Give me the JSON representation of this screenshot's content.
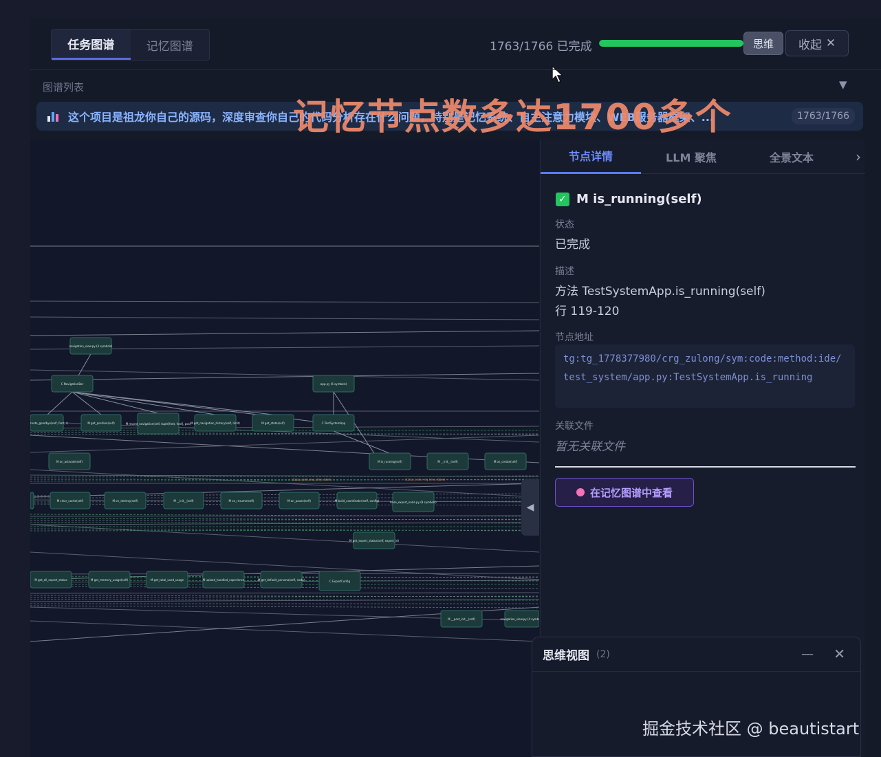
{
  "tabs": [
    {
      "label": "任务图谱",
      "active": true
    },
    {
      "label": "记忆图谱",
      "active": false
    }
  ],
  "progress": {
    "text": "1763/1766 已完成",
    "done": 1763,
    "total": 1766
  },
  "buttons": {
    "think": "思维",
    "collapse": "收起"
  },
  "graph_list": {
    "title": "图谱列表",
    "item_text": "这个项目是祖龙你自己的源码，深度审查你自己的代码分析存在什么问题，特别是记忆系统、自主注意力模块、WEB服务器框架、...",
    "item_count": "1763/1766"
  },
  "overlay_caption": "记忆节点数多达1700多个",
  "graph_nodes": [
    {
      "label": "navigation_view.py (4 symbols)"
    },
    {
      "label": "C NavigationBar"
    },
    {
      "label": "app.py (6 symbols)"
    },
    {
      "label": "M create_goodbye(self, font, r)"
    },
    {
      "label": "M get_position(self)"
    },
    {
      "label": "M record_navigation(self, tuple[font, font], pos)"
    },
    {
      "label": "M get_navigation_history(self, limit)"
    },
    {
      "label": "M get_state(self)"
    },
    {
      "label": "C TestSystemApp"
    },
    {
      "label": "M on_activate(self)"
    },
    {
      "label": "M is_running(self)"
    },
    {
      "label": "M __init__(self)"
    },
    {
      "label": "M on_create(self)"
    },
    {
      "label": "M get_state(self)"
    },
    {
      "label": "M clear_cache(self)"
    },
    {
      "label": "M on_destroy(self)"
    },
    {
      "label": "M __init__(self)"
    },
    {
      "label": "M on_resume(self)"
    },
    {
      "label": "M on_pause(self)"
    },
    {
      "label": "M build_coordinator(self, config)"
    },
    {
      "label": "base_expert_node.py (8 symbols)"
    },
    {
      "label": "M get_expert_status(self, expert_id)"
    },
    {
      "label": "M get_all_expert_status"
    },
    {
      "label": "M get_memory_usage(self)"
    },
    {
      "label": "M get_total_used_usage"
    },
    {
      "label": "M upload_handled_experience"
    },
    {
      "label": "M get_default_persona(self, node)"
    },
    {
      "label": "C ExpertConfig"
    },
    {
      "label": "M __post_init__(self)"
    }
  ],
  "graph_edge_labels": [
    "status_code, req_time, labels",
    "status_code, req_time, labels"
  ],
  "panel": {
    "tabs": [
      "节点详情",
      "LLM 聚焦",
      "全景文本"
    ],
    "next_icon": "chevron-right-icon",
    "node_title": "M is_running(self)",
    "status_label": "状态",
    "status_value": "已完成",
    "desc_label": "描述",
    "desc_line1": "方法 TestSystemApp.is_running(self)",
    "desc_line2": "行 119-120",
    "addr_label": "节点地址",
    "addr_value": "tg:tg_1778377980/crg_zulong/sym:code:method:ide/test_system/app.py:TestSystemApp.is_running",
    "file_label": "关联文件",
    "file_value": "暂无关联文件",
    "memory_button": "在记忆图谱中查看"
  },
  "mind_view": {
    "title": "思维视图",
    "count": "(2)"
  },
  "watermark": "掘金技术社区 @ beautistart",
  "colors": {
    "accent": "#5a7cff",
    "success": "#22c55e",
    "caption": "#f08a6b",
    "link": "#7b8fd8"
  }
}
